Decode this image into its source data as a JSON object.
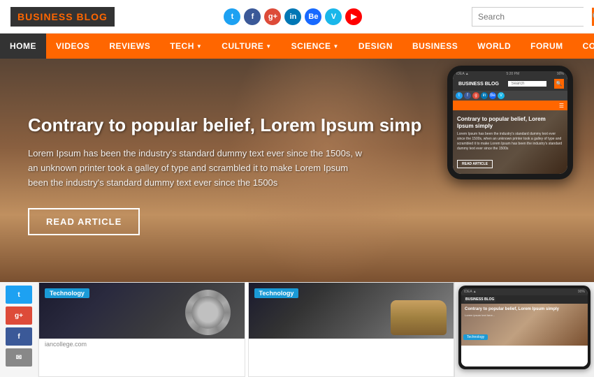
{
  "header": {
    "logo_text": "BUSINESS BLOG",
    "search_placeholder": "Search"
  },
  "nav": {
    "items": [
      {
        "label": "HOME",
        "active": true,
        "has_dropdown": false
      },
      {
        "label": "VIDEOS",
        "active": false,
        "has_dropdown": false
      },
      {
        "label": "REVIEWS",
        "active": false,
        "has_dropdown": false
      },
      {
        "label": "TECH",
        "active": false,
        "has_dropdown": true
      },
      {
        "label": "CULTURE",
        "active": false,
        "has_dropdown": true
      },
      {
        "label": "SCIENCE",
        "active": false,
        "has_dropdown": true
      },
      {
        "label": "DESIGN",
        "active": false,
        "has_dropdown": false
      },
      {
        "label": "BUSINESS",
        "active": false,
        "has_dropdown": false
      },
      {
        "label": "WORLD",
        "active": false,
        "has_dropdown": false
      },
      {
        "label": "FORUM",
        "active": false,
        "has_dropdown": false
      },
      {
        "label": "CONTACT",
        "active": false,
        "has_dropdown": false
      }
    ]
  },
  "hero": {
    "title": "Contrary to popular belief, Lorem Ipsum simp",
    "body_text": "Lorem Ipsum has been the industry's standard dummy text ever since the 1500s, w\nan unknown printer took a galley of type and scrambled it to make Lorem Ipsum\nbeen the industry's standard dummy text ever since the 1500s",
    "cta_label": "READ ARTICLE"
  },
  "mobile": {
    "logo": "BUSINESS BLOG",
    "search_placeholder": "Search",
    "hero_title": "Contrary to popular belief, Lorem Ipsum simply",
    "hero_text": "Lorem Ipsum has been the industry's standard dummy text ever since the 1500s, when an unknown printer took a galley of type and scrambled it to make Lorem Ipsum has been the industry's standard dummy text ever since the 1500s",
    "cta_label": "READ ARTICLE",
    "status_bar": "IDEA ▲",
    "time": "5:20 PM",
    "battery": "90%"
  },
  "cards": [
    {
      "tag": "Technology",
      "url": "iancollege.com"
    },
    {
      "tag": "Technology",
      "url": ""
    }
  ],
  "social_sidebar": {
    "items": [
      "t",
      "g+",
      "f",
      "✉"
    ]
  }
}
